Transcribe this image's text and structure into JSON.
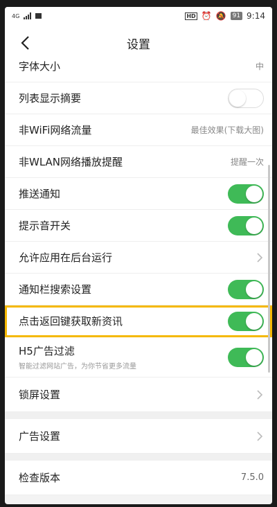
{
  "status": {
    "carrier": "4G",
    "battery": "91",
    "time": "9:14",
    "hd": "HD"
  },
  "header": {
    "title": "设置"
  },
  "settings": {
    "font_size": {
      "label": "字体大小",
      "value": "中"
    },
    "summary": {
      "label": "列表显示摘要",
      "state": "off"
    },
    "nonwifi": {
      "label": "非WiFi网络流量",
      "value": "最佳效果(下载大图)"
    },
    "nonwlan": {
      "label": "非WLAN网络播放提醒",
      "value": "提醒一次"
    },
    "push": {
      "label": "推送通知",
      "state": "on"
    },
    "sound": {
      "label": "提示音开关",
      "state": "on"
    },
    "background": {
      "label": "允许应用在后台运行"
    },
    "notif_search": {
      "label": "通知栏搜索设置",
      "state": "on"
    },
    "back_refresh": {
      "label": "点击返回键获取新资讯",
      "state": "on"
    },
    "h5_filter": {
      "label": "H5广告过滤",
      "sub": "智能过滤网站广告，为你节省更多流量",
      "state": "on"
    },
    "lock_screen": {
      "label": "锁屏设置"
    },
    "ad_settings": {
      "label": "广告设置"
    },
    "check_version": {
      "label": "检查版本",
      "value": "7.5.0"
    }
  },
  "colors": {
    "toggle_on": "#3fba57",
    "highlight": "#f5b800"
  }
}
